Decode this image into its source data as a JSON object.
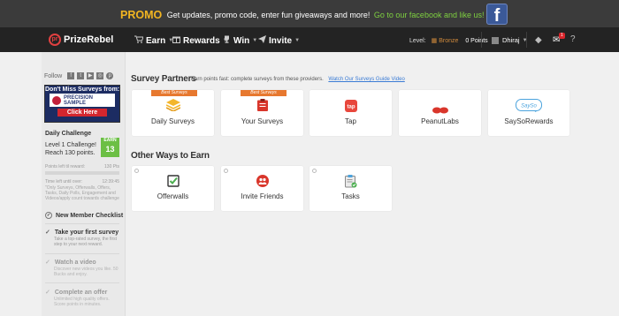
{
  "promo": {
    "strong": "PROMO",
    "body": "Get updates, promo code, enter fun giveaways and more!",
    "link": "Go to our facebook and like us!",
    "fb_icon": "facebook-icon"
  },
  "nav": {
    "logo_text": "PrizeRebel",
    "items": [
      {
        "label": "Earn",
        "icon": "cart-icon"
      },
      {
        "label": "Rewards",
        "icon": "gift-icon"
      },
      {
        "label": "Win",
        "icon": "trophy-icon"
      },
      {
        "label": "Invite",
        "icon": "send-icon"
      }
    ],
    "level_label": "Level:",
    "level_value": "Bronze",
    "points": "0 Points",
    "user_name": "Dhiraj",
    "mail_badge": "1"
  },
  "sidebar": {
    "follow_label": "Follow",
    "social_icons": [
      "facebook-icon",
      "twitter-icon",
      "youtube-icon",
      "instagram-icon",
      "pinterest-icon"
    ],
    "ad": {
      "top": "Don't Miss Surveys from:",
      "brand_line1": "PRECISION",
      "brand_line2": "SAMPLE",
      "button": "Click Here"
    },
    "daily_challenge": {
      "title": "Daily Challenge",
      "line1": "Level 1 Challenge!",
      "line2": "Reach 130 points.",
      "earn_label": "EARN",
      "earn_value": "13",
      "points_left_label": "Points left til reward:",
      "points_left_value": "130 Pts",
      "progress": 0,
      "time_label": "Time left until over:",
      "time_value": "12:39:45",
      "note": "\"Only Surveys, Offerwalls, Offers, Tasks, Daily Polls, Engagement and Videos/apply count towards challenge"
    },
    "checklist": {
      "title": "New Member Checklist",
      "items": [
        {
          "title": "Take your first survey",
          "desc": "Take a top-rated survey, the first step to your next reward."
        },
        {
          "title": "Watch a video",
          "desc": "Discover new videos you like. 50 Bucks and enjoy."
        },
        {
          "title": "Complete an offer",
          "desc": "Unlimited high quality offers. Score points in minutes."
        }
      ]
    }
  },
  "main": {
    "survey_partners": {
      "title": "Survey Partners",
      "subtitle": "Earn points fast: complete surveys from these providers.",
      "link": "Watch Our Surveys Guide Video",
      "cards": [
        {
          "label": "Daily Surveys",
          "ribbon": "Best Surveys",
          "icon": "layers-icon"
        },
        {
          "label": "Your Surveys",
          "ribbon": "Best Surveys",
          "icon": "clipboard-icon"
        },
        {
          "label": "Tap",
          "ribbon": "",
          "icon": "tap-logo-icon"
        },
        {
          "label": "PeanutLabs",
          "ribbon": "",
          "icon": "peanut-icon"
        },
        {
          "label": "SaySoRewards",
          "ribbon": "",
          "icon": "sayso-logo-icon"
        }
      ]
    },
    "other_ways": {
      "title": "Other Ways to Earn",
      "cards": [
        {
          "label": "Offerwalls",
          "icon": "checkbox-icon"
        },
        {
          "label": "Invite Friends",
          "icon": "friends-icon"
        },
        {
          "label": "Tasks",
          "icon": "tasks-icon"
        }
      ]
    }
  },
  "colors": {
    "promo_bg": "#3b3b3b",
    "promo_accent": "#f2b521",
    "promo_link": "#7ed040",
    "nav_bg": "#232323",
    "ribbon": "#e7782f",
    "earn_green": "#6cbf45"
  }
}
